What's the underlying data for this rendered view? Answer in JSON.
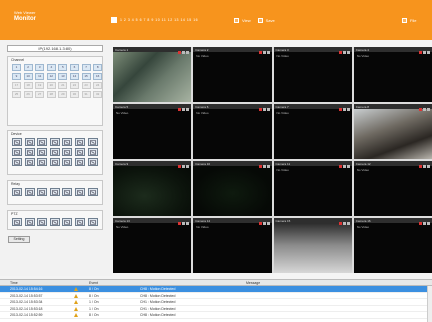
{
  "header": {
    "brand_top": "Web Viewer",
    "brand_main": "Monitor",
    "channel_numbers": "1  2  3  4  5  6  7  8  9  10  11  12  13  14  15  16",
    "view_label": "View",
    "save_label": "Save",
    "file_label": "File"
  },
  "left": {
    "ip": "IP(192.168.1.3:80)",
    "channel_title": "Channel",
    "channels": [
      "1",
      "2",
      "3",
      "4",
      "5",
      "6",
      "7",
      "8",
      "9",
      "10",
      "11",
      "12",
      "13",
      "14",
      "15",
      "16",
      "17",
      "18",
      "19",
      "20",
      "21",
      "22",
      "23",
      "24",
      "25",
      "26",
      "27",
      "28",
      "29",
      "30",
      "31",
      "32"
    ],
    "device_title": "Device",
    "relay_title": "Relay",
    "ptz_title": "PTZ",
    "setting_label": "Setting"
  },
  "cameras": [
    {
      "name": "Camera 1",
      "status": "",
      "feed": "feed1"
    },
    {
      "name": "Camera 2",
      "status": "No Video",
      "feed": ""
    },
    {
      "name": "Camera 3",
      "status": "No Video",
      "feed": ""
    },
    {
      "name": "Camera 4",
      "status": "No Video",
      "feed": ""
    },
    {
      "name": "Camera 5",
      "status": "No Video",
      "feed": ""
    },
    {
      "name": "Camera 6",
      "status": "No Video",
      "feed": ""
    },
    {
      "name": "Camera 7",
      "status": "No Video",
      "feed": ""
    },
    {
      "name": "Camera 8",
      "status": "",
      "feed": "feed2"
    },
    {
      "name": "Camera 9",
      "status": "",
      "feed": "feed3"
    },
    {
      "name": "Camera 10",
      "status": "",
      "feed": "feed4"
    },
    {
      "name": "Camera 11",
      "status": "No Video",
      "feed": ""
    },
    {
      "name": "Camera 12",
      "status": "No Video",
      "feed": ""
    },
    {
      "name": "Camera 13",
      "status": "No Video",
      "feed": ""
    },
    {
      "name": "Camera 14",
      "status": "No Video",
      "feed": ""
    },
    {
      "name": "Camera 15",
      "status": "",
      "feed": "feed5"
    },
    {
      "name": "Camera 16",
      "status": "No Video",
      "feed": ""
    }
  ],
  "events": {
    "headers": {
      "time": "Time",
      "event": "Event",
      "message": "Message"
    },
    "rows": [
      {
        "time": "2013-02-14 15:54:16",
        "event": "8 / On",
        "message": "CH8 : Motion Detected",
        "selected": true
      },
      {
        "time": "2013-02-14 15:53:57",
        "event": "8 / On",
        "message": "CH8 : Motion Detected",
        "selected": false
      },
      {
        "time": "2013-02-14 15:53:34",
        "event": "1 / On",
        "message": "CH1 : Motion Detected",
        "selected": false
      },
      {
        "time": "2013-02-14 15:53:18",
        "event": "1 / On",
        "message": "CH1 : Motion Detected",
        "selected": false
      },
      {
        "time": "2013-02-14 15:52:59",
        "event": "8 / On",
        "message": "CH8 : Motion Detected",
        "selected": false
      }
    ]
  },
  "colors": {
    "header": "#f7941d",
    "selected_row": "#3b8fe0"
  }
}
